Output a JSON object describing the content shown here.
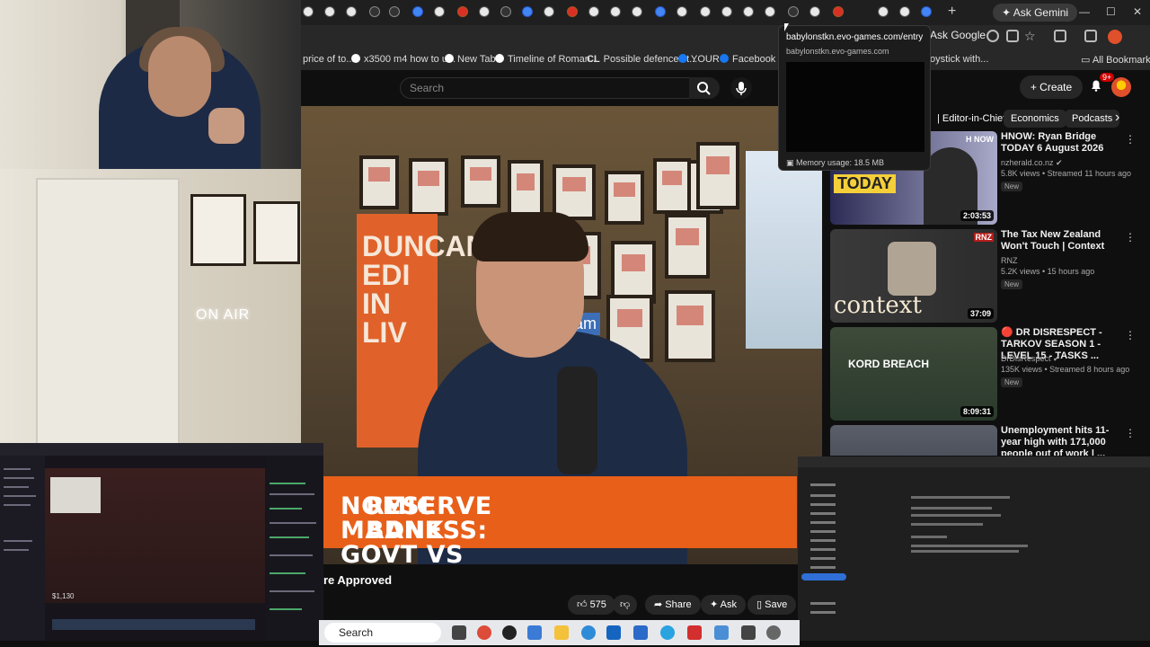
{
  "browser": {
    "new_tab_symbol": "+",
    "ask_gemini_label": "Ask Gemini",
    "ask_google_label": "Ask Google",
    "window_controls": [
      "—",
      "☐",
      "✕"
    ],
    "bookmarks": [
      {
        "label": "price of to...",
        "icon": "page-icon"
      },
      {
        "label": "x3500 m4 how to u...",
        "icon": "google-icon"
      },
      {
        "label": "New Tab",
        "icon": "new-tab-icon"
      },
      {
        "label": "Timeline of Roman...",
        "icon": "wikipedia-icon"
      },
      {
        "label": "Possible defences t...",
        "icon": "cl-icon"
      },
      {
        "label": "YOUR",
        "icon": "facebook-icon"
      },
      {
        "label": "Facebook gre...",
        "icon": "facebook-icon"
      },
      {
        "label": "oystick with...",
        "icon": "page-icon"
      }
    ],
    "all_bookmarks_label": "All Bookmarks",
    "tab_tooltip": {
      "title": "babylonstkn.evo-games.com/entry",
      "url": "babylonstkn.evo-games.com",
      "memory": "Memory usage: 18.5 MB"
    }
  },
  "youtube": {
    "search_placeholder": "Search",
    "create_label": "Create",
    "notification_badge": "9+",
    "chips": [
      "| Editor-in-Chief",
      "Economics",
      "Podcasts"
    ],
    "chip_next_symbol": "›",
    "video": {
      "sign_text": "DUNCAN EDI... IN... LIV...",
      "sign_display": "DUNCAN EDI IN LIV",
      "neon_text": "ON AIR",
      "am_text": ".am",
      "lower_third_line1": "NOMIC MADNESS: GOVT VS",
      "lower_third_line2": "RESERVE BANK",
      "title_fragment": "re Approved"
    },
    "actions": {
      "like_count": "575",
      "share_label": "Share",
      "ask_label": "Ask",
      "save_label": "Save"
    },
    "recommended": [
      {
        "title": "HNOW: Ryan Bridge TODAY 6 August 2026",
        "channel": "nzherald.co.nz ✔",
        "meta": "5.8K views • Streamed 11 hours ago",
        "badge": "New",
        "duration": "2:03:53",
        "thumb_text": "TODAY",
        "thumb_tag": "H NOW"
      },
      {
        "title": "The Tax New Zealand Won't Touch | Context",
        "channel": "RNZ",
        "meta": "5.2K views • 15 hours ago",
        "badge": "New",
        "duration": "37:09",
        "thumb_text": "context",
        "thumb_tag": "RNZ"
      },
      {
        "title": "🔴 DR DISRESPECT - TARKOV SEASON 1 - LEVEL 15 - TASKS ...",
        "channel": "DrDisRespect ✔",
        "meta": "135K views • Streamed 8 hours ago",
        "badge": "New",
        "duration": "8:09:31",
        "thumb_text": "KORD BREACH",
        "thumb_tag": ""
      },
      {
        "title": "Unemployment hits 11-year high with 171,000 people out of work | ...",
        "channel": "",
        "meta": "",
        "badge": "",
        "duration": "",
        "thumb_text": "",
        "thumb_tag": ""
      }
    ]
  },
  "taskbar": {
    "search_label": "Search"
  },
  "nested_stream": {
    "viewer_count": "$1,130"
  },
  "colors": {
    "youtube_bg": "#0f0f0f",
    "lower_third": "#e85f19",
    "notification_red": "#cc0000"
  }
}
